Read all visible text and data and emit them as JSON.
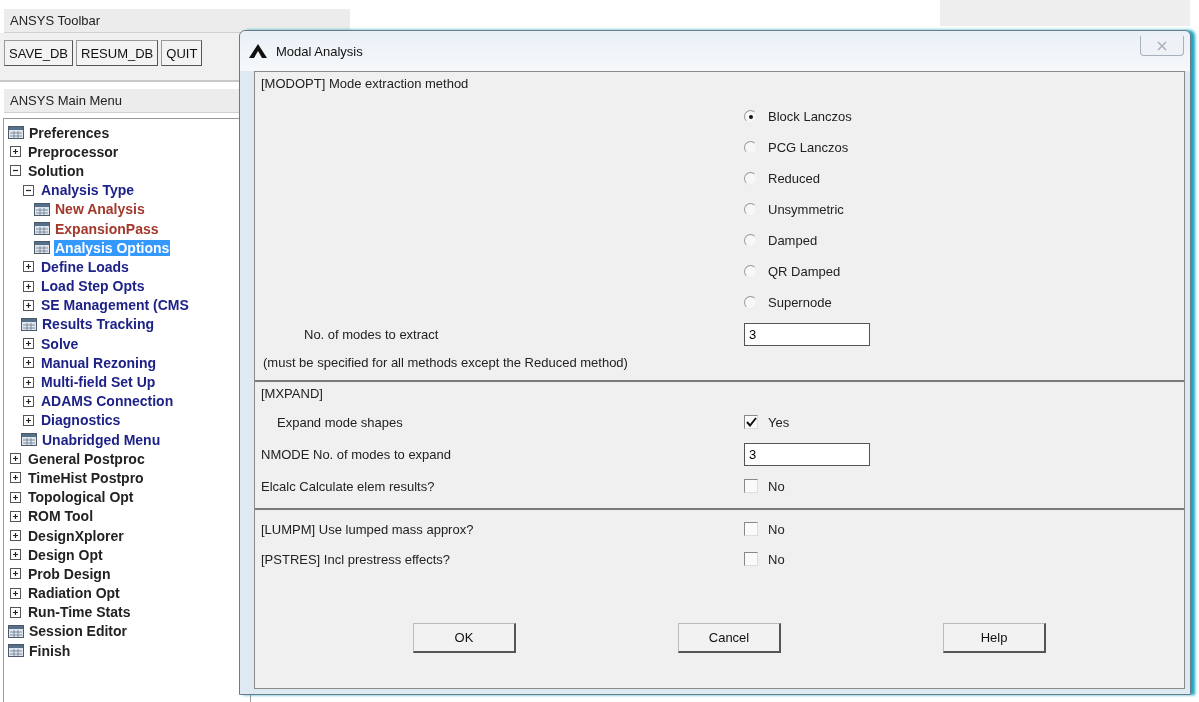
{
  "toolbar": {
    "title": "ANSYS Toolbar",
    "buttons": [
      "SAVE_DB",
      "RESUM_DB",
      "QUIT"
    ]
  },
  "main_menu": {
    "title": "ANSYS Main Menu",
    "items": [
      {
        "label": "Preferences",
        "kind": "command",
        "selected": false
      },
      {
        "label": "Preprocessor",
        "kind": "expander",
        "expanded": false,
        "selected": false
      },
      {
        "label": "Solution",
        "kind": "expander",
        "expanded": true,
        "selected": false,
        "children": [
          {
            "label": "Analysis Type",
            "kind": "expander",
            "expanded": true,
            "selected": false,
            "children": [
              {
                "label": "New Analysis",
                "kind": "command",
                "selected": false,
                "color": "#a3382c"
              },
              {
                "label": "ExpansionPass",
                "kind": "command",
                "selected": false,
                "color": "#a3382c"
              },
              {
                "label": "Analysis Options",
                "kind": "command",
                "selected": true
              }
            ]
          },
          {
            "label": "Define Loads",
            "kind": "expander",
            "expanded": false,
            "selected": false
          },
          {
            "label": "Load Step Opts",
            "kind": "expander",
            "expanded": false,
            "selected": false
          },
          {
            "label": "SE Management (CMS",
            "kind": "expander",
            "expanded": false,
            "selected": false
          },
          {
            "label": "Results Tracking",
            "kind": "command",
            "selected": false
          },
          {
            "label": "Solve",
            "kind": "expander",
            "expanded": false,
            "selected": false
          },
          {
            "label": "Manual Rezoning",
            "kind": "expander",
            "expanded": false,
            "selected": false
          },
          {
            "label": "Multi-field Set Up",
            "kind": "expander",
            "expanded": false,
            "selected": false
          },
          {
            "label": "ADAMS Connection",
            "kind": "expander",
            "expanded": false,
            "selected": false
          },
          {
            "label": "Diagnostics",
            "kind": "expander",
            "expanded": false,
            "selected": false
          },
          {
            "label": "Unabridged Menu",
            "kind": "command",
            "selected": false
          }
        ]
      },
      {
        "label": "General Postproc",
        "kind": "expander",
        "expanded": false,
        "selected": false
      },
      {
        "label": "TimeHist Postpro",
        "kind": "expander",
        "expanded": false,
        "selected": false
      },
      {
        "label": "Topological Opt",
        "kind": "expander",
        "expanded": false,
        "selected": false
      },
      {
        "label": "ROM Tool",
        "kind": "expander",
        "expanded": false,
        "selected": false
      },
      {
        "label": "DesignXplorer",
        "kind": "expander",
        "expanded": false,
        "selected": false
      },
      {
        "label": "Design Opt",
        "kind": "expander",
        "expanded": false,
        "selected": false
      },
      {
        "label": "Prob Design",
        "kind": "expander",
        "expanded": false,
        "selected": false
      },
      {
        "label": "Radiation Opt",
        "kind": "expander",
        "expanded": false,
        "selected": false
      },
      {
        "label": "Run-Time Stats",
        "kind": "expander",
        "expanded": false,
        "selected": false
      },
      {
        "label": "Session Editor",
        "kind": "command",
        "selected": false
      },
      {
        "label": "Finish",
        "kind": "command",
        "selected": false
      }
    ]
  },
  "dialog": {
    "title": "Modal Analysis",
    "sections": [
      {
        "heading": "[MODOPT] Mode extraction method",
        "rows": [
          {
            "kind": "radios",
            "options": [
              {
                "label": "Block Lanczos",
                "selected": true
              },
              {
                "label": "PCG Lanczos",
                "selected": false
              },
              {
                "label": "Reduced",
                "selected": false
              },
              {
                "label": "Unsymmetric",
                "selected": false
              },
              {
                "label": "Damped",
                "selected": false
              },
              {
                "label": "QR Damped",
                "selected": false
              },
              {
                "label": "Supernode",
                "selected": false
              }
            ]
          },
          {
            "kind": "field",
            "label": "No. of modes to extract",
            "value": "3",
            "indent": true
          },
          {
            "kind": "note",
            "text": "(must be specified for all methods except the Reduced method)"
          }
        ]
      },
      {
        "heading": "[MXPAND]",
        "rows": [
          {
            "kind": "checkbox",
            "label": "Expand mode shapes",
            "option": "Yes",
            "checked": true,
            "indent": true
          },
          {
            "kind": "field",
            "label": "NMODE No. of modes to expand",
            "value": "3"
          },
          {
            "kind": "checkbox",
            "label": "Elcalc  Calculate elem results?",
            "option": "No",
            "checked": false
          }
        ]
      },
      {
        "rows": [
          {
            "kind": "checkbox",
            "label": "[LUMPM]  Use lumped mass approx?",
            "option": "No",
            "checked": false
          },
          {
            "kind": "checkbox",
            "label": "[PSTRES] Incl prestress effects?",
            "option": "No",
            "checked": false
          }
        ]
      }
    ],
    "buttons": [
      "OK",
      "Cancel",
      "Help"
    ]
  }
}
